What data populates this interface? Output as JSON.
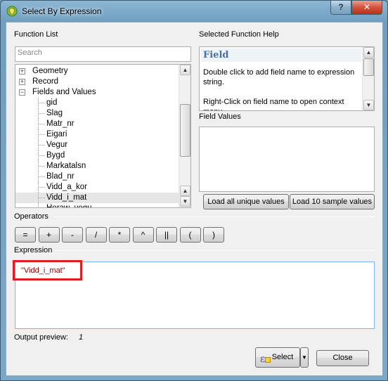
{
  "window": {
    "title": "Select By Expression",
    "help_glyph": "?",
    "close_glyph": "✕"
  },
  "function_list": {
    "label": "Function List",
    "search_placeholder": "Search",
    "tree": [
      {
        "label": "Geometry",
        "kind": "group",
        "state": "collapsed"
      },
      {
        "label": "Record",
        "kind": "group",
        "state": "collapsed"
      },
      {
        "label": "Fields and Values",
        "kind": "group",
        "state": "expanded"
      },
      {
        "label": "gid",
        "kind": "leaf"
      },
      {
        "label": "Slag",
        "kind": "leaf"
      },
      {
        "label": "Matr_nr",
        "kind": "leaf"
      },
      {
        "label": "Eigari",
        "kind": "leaf"
      },
      {
        "label": "Vegur",
        "kind": "leaf"
      },
      {
        "label": "Bygd",
        "kind": "leaf"
      },
      {
        "label": "Markatalsn",
        "kind": "leaf"
      },
      {
        "label": "Blad_nr",
        "kind": "leaf"
      },
      {
        "label": "Vidd_a_kor",
        "kind": "leaf"
      },
      {
        "label": "Vidd_i_mat",
        "kind": "leaf",
        "selected": true
      },
      {
        "label": "Heraw_vegu",
        "kind": "leaf"
      }
    ]
  },
  "help": {
    "label": "Selected Function Help",
    "title": "Field",
    "line1": "Double click to add field name to expression string.",
    "line2": "Right-Click on field name to open context menu"
  },
  "field_values": {
    "label": "Field Values",
    "load_all": "Load all unique values",
    "load_sample": "Load 10 sample values"
  },
  "operators": {
    "label": "Operators",
    "items": [
      "=",
      "+",
      "-",
      "/",
      "*",
      "^",
      "||",
      "(",
      ")"
    ]
  },
  "expression": {
    "label": "Expression",
    "value": "\"Vidd_i_mat\""
  },
  "output_preview": {
    "label": "Output preview:",
    "value": "1"
  },
  "buttons": {
    "select": "Select",
    "close": "Close"
  },
  "colors": {
    "highlight": "#e31b23",
    "expression_text": "#8b0000",
    "help_title": "#4a6fa5"
  }
}
